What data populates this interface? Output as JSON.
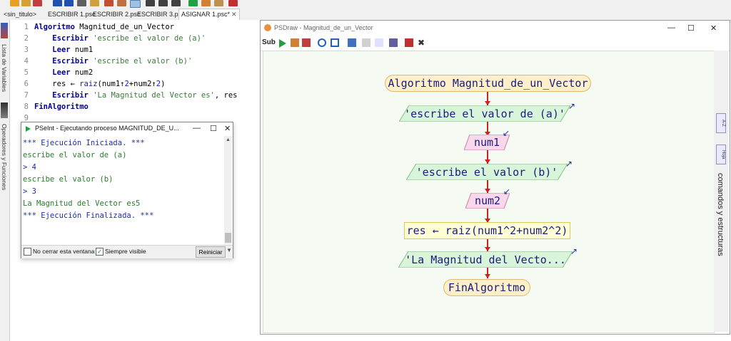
{
  "tabs": [
    {
      "label": "<sin_titulo>"
    },
    {
      "label": "ESCRIBIR 1.psc"
    },
    {
      "label": "ESCRIBIR 2.psc"
    },
    {
      "label": "ESCRIBIR 3.psc"
    },
    {
      "label": "ASIGNAR 1.psc*",
      "active": true,
      "close": "✕"
    }
  ],
  "left_strip": {
    "lista_variables": "Lista de Variables",
    "operadores": "Operadores y Funciones"
  },
  "editor": {
    "line_numbers": [
      "1",
      "2",
      "3",
      "4",
      "5",
      "6",
      "7",
      "8",
      "9"
    ],
    "lines": [
      {
        "kw": "Algoritmo",
        "rest": " Magnitud_de_un_Vector"
      },
      {
        "kw": "Escribir",
        "str": " 'escribe el valor de (a)'"
      },
      {
        "kw": "Leer",
        "rest": " num1"
      },
      {
        "kw": "Escribir",
        "str": " 'escribe el valor (b)'"
      },
      {
        "kw": "Leer",
        "rest": " num2"
      },
      {
        "pre": "res ← ",
        "fn": "raiz",
        "post_a": "(num1↑",
        "n1": "2",
        "post_b": "+num2↑",
        "n2": "2",
        "post_c": ")"
      },
      {
        "kw": "Escribir",
        "str": " 'La Magnitud del Vector es'",
        "rest": ", res"
      },
      {
        "kw": "FinAlgoritmo"
      },
      {
        "kw": ""
      }
    ]
  },
  "console": {
    "title": "PSeInt - Ejecutando proceso MAGNITUD_DE_U...",
    "lines": [
      {
        "text": "*** Ejecución Iniciada. ***",
        "color": "blue"
      },
      {
        "text": "escribe el valor de (a)",
        "color": "green"
      },
      {
        "text": "> 4",
        "color": "blue"
      },
      {
        "text": "escribe el valor (b)",
        "color": "green"
      },
      {
        "text": "> 3",
        "color": "blue"
      },
      {
        "text": "La Magnitud del Vector es5",
        "color": "green"
      },
      {
        "text": "*** Ejecución Finalizada. ***",
        "color": "blue"
      }
    ],
    "no_cerrar_label": "No cerrar esta ventana",
    "no_cerrar_checked": false,
    "siempre_visible_label": "Siempre visible",
    "siempre_visible_checked": true,
    "reiniciar_label": "Reiniciar"
  },
  "psdraw": {
    "title": "PSDraw - Magnitud_de_un_Vector",
    "toolbar_sub_label": "Sub",
    "side_label": "comandos y estructuras",
    "side_mini_labels": [
      "A-Z",
      "Hoja"
    ],
    "flow": [
      {
        "type": "terminal",
        "text": "Algoritmo Magnitud_de_un_Vector"
      },
      {
        "type": "output",
        "text": "'escribe el valor de (a)'"
      },
      {
        "type": "input",
        "text": "num1"
      },
      {
        "type": "output",
        "text": "'escribe el valor (b)'"
      },
      {
        "type": "input",
        "text": "num2"
      },
      {
        "type": "process",
        "text": "res ← raiz(num1^2+num2^2)"
      },
      {
        "type": "output",
        "text": "'La Magnitud del Vecto..."
      },
      {
        "type": "terminal",
        "text": "FinAlgoritmo"
      }
    ],
    "colors": {
      "output_fill": "#d9f5d9",
      "input_fill": "#f8d8ea",
      "terminal_fill": "#fdf0c8",
      "process_fill": "#ffffd6",
      "connector": "#d02020"
    }
  },
  "window_controls": {
    "min": "—",
    "max": "☐",
    "close": "✕"
  }
}
